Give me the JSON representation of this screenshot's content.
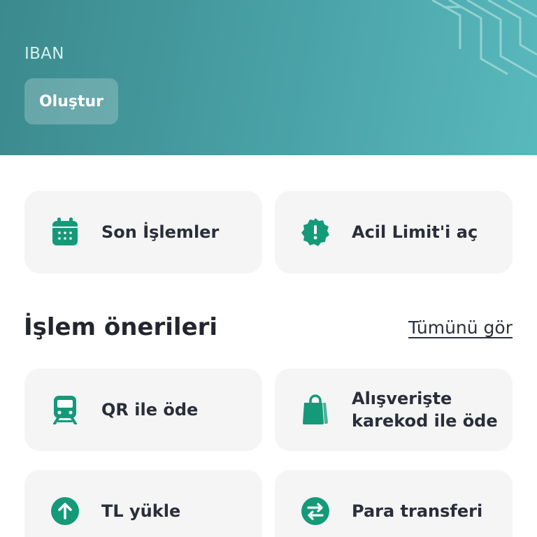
{
  "header": {
    "iban_label": "IBAN",
    "create_button": "Oluştur",
    "gradient_colors": [
      "#3b8a8d",
      "#58b9bd"
    ]
  },
  "quick_actions": [
    {
      "label": "Son İşlemler",
      "icon": "calendar-icon"
    },
    {
      "label": "Acil Limit'i aç",
      "icon": "alert-badge-icon"
    }
  ],
  "suggestions": {
    "title": "İşlem önerileri",
    "see_all": "Tümünü gör",
    "items": [
      {
        "label": "QR ile öde",
        "icon": "train-icon"
      },
      {
        "label": "Alışverişte\nkarekod ile öde",
        "icon": "shopping-bag-icon"
      },
      {
        "label": "TL yükle",
        "icon": "arrow-up-circle-icon"
      },
      {
        "label": "Para transferi",
        "icon": "transfer-arrows-icon"
      }
    ]
  },
  "colors": {
    "accent": "#149a79",
    "card_bg": "#f5f5f5",
    "text_dark": "#2a2e3a"
  }
}
